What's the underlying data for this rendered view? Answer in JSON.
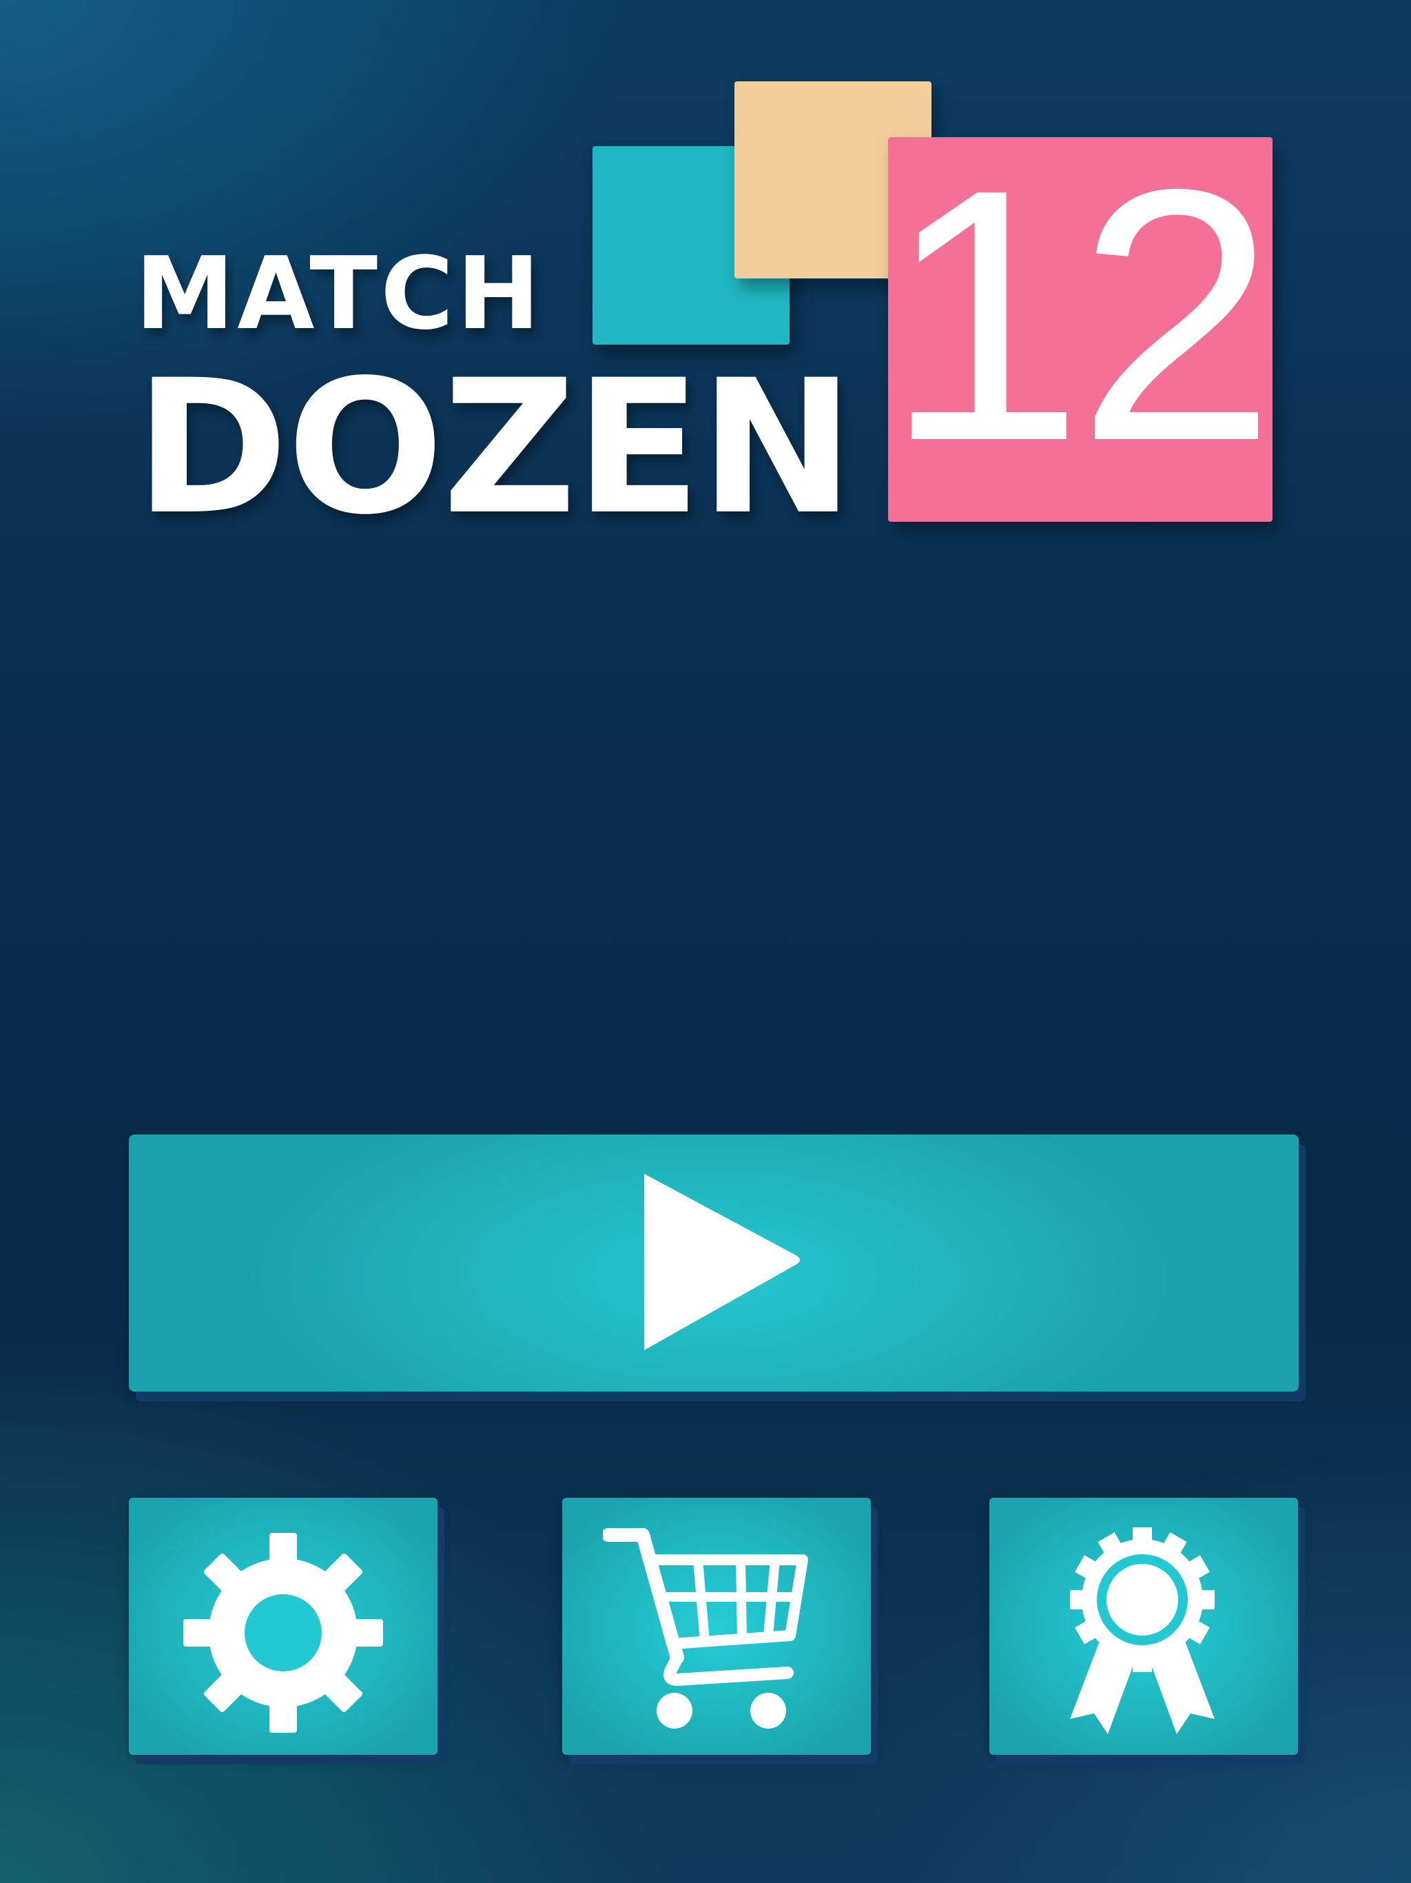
{
  "logo": {
    "line1": "MATCH",
    "line2": "DOZEN",
    "number": "12"
  },
  "colors": {
    "background": "#0a2d4e",
    "accent_teal": "#1fb7c1",
    "tile_sand": "#f2cd9c",
    "tile_pink": "#f57096",
    "button_shadow": "#123c66",
    "icon": "#ffffff"
  },
  "buttons": {
    "play": {
      "icon": "play-icon"
    },
    "settings": {
      "icon": "gear-icon"
    },
    "shop": {
      "icon": "shopping-cart-icon"
    },
    "awards": {
      "icon": "award-ribbon-icon"
    }
  }
}
